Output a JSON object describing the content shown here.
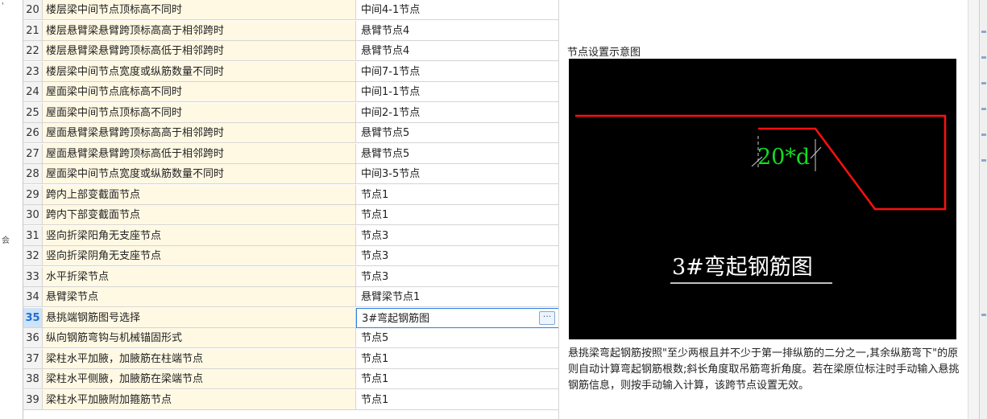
{
  "table": {
    "rows": [
      {
        "no": "20",
        "name": "楼层梁中间节点顶标高不同时",
        "value": "中间4-1节点"
      },
      {
        "no": "21",
        "name": "楼层悬臂梁悬臂跨顶标高高于相邻跨时",
        "value": "悬臂节点4"
      },
      {
        "no": "22",
        "name": "楼层悬臂梁悬臂跨顶标高低于相邻跨时",
        "value": "悬臂节点4"
      },
      {
        "no": "23",
        "name": "楼层梁中间节点宽度或纵筋数量不同时",
        "value": "中间7-1节点"
      },
      {
        "no": "24",
        "name": "屋面梁中间节点底标高不同时",
        "value": "中间1-1节点"
      },
      {
        "no": "25",
        "name": "屋面梁中间节点顶标高不同时",
        "value": "中间2-1节点"
      },
      {
        "no": "26",
        "name": "屋面悬臂梁悬臂跨顶标高高于相邻跨时",
        "value": "悬臂节点5"
      },
      {
        "no": "27",
        "name": "屋面悬臂梁悬臂跨顶标高低于相邻跨时",
        "value": "悬臂节点5"
      },
      {
        "no": "28",
        "name": "屋面梁中间节点宽度或纵筋数量不同时",
        "value": "中间3-5节点"
      },
      {
        "no": "29",
        "name": "跨内上部变截面节点",
        "value": "节点1"
      },
      {
        "no": "30",
        "name": "跨内下部变截面节点",
        "value": "节点1"
      },
      {
        "no": "31",
        "name": "竖向折梁阳角无支座节点",
        "value": "节点3"
      },
      {
        "no": "32",
        "name": "竖向折梁阴角无支座节点",
        "value": "节点3"
      },
      {
        "no": "33",
        "name": "水平折梁节点",
        "value": "节点3"
      },
      {
        "no": "34",
        "name": "悬臂梁节点",
        "value": "悬臂梁节点1"
      },
      {
        "no": "35",
        "name": "悬挑端钢筋图号选择",
        "value": "3#弯起钢筋图",
        "selected": true
      },
      {
        "no": "36",
        "name": "纵向钢筋弯钩与机械锚固形式",
        "value": "节点5"
      },
      {
        "no": "37",
        "name": "梁柱水平加腋，加腋筋在柱端节点",
        "value": "节点1"
      },
      {
        "no": "38",
        "name": "梁柱水平侧腋，加腋筋在梁端节点",
        "value": "节点1"
      },
      {
        "no": "39",
        "name": "梁柱水平加腋附加箍筋节点",
        "value": "节点1"
      }
    ],
    "more_button": "···"
  },
  "panel": {
    "title": "节点设置示意图",
    "diagram_dimension_label": "20*d",
    "diagram_caption": "3#弯起钢筋图",
    "description": "悬挑梁弯起钢筋按照\"至少两根且并不少于第一排纵筋的二分之一,其余纵筋弯下\"的原则自动计算弯起钢筋根数;斜长角度取吊筋弯折角度。若在梁原位标注时手动输入悬挑钢筋信息，则按手动输入计算，该跨节点设置无效。"
  },
  "gutter": {
    "top_mark": "'",
    "mid_mark": "会"
  },
  "colors": {
    "name_cell_bg": "#fff9e4",
    "selected_border": "#2c7fe0",
    "rebar_red": "#ff0000",
    "dim_green": "#00cc00"
  }
}
